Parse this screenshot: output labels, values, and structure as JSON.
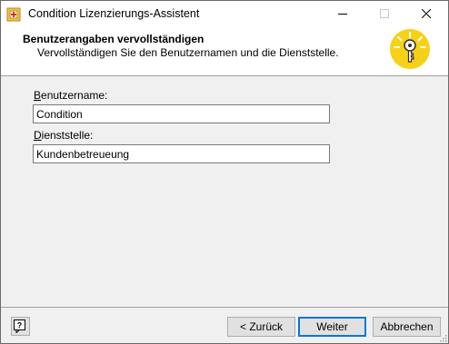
{
  "window": {
    "title": "Condition Lizenzierungs-Assistent"
  },
  "header": {
    "title": "Benutzerangaben vervollständigen",
    "subtitle": "Vervollständigen Sie den Benutzernamen und die Dienststelle."
  },
  "form": {
    "username": {
      "label_mnemonic": "B",
      "label_rest": "enutzername:",
      "value": "Condition"
    },
    "department": {
      "label_mnemonic": "D",
      "label_rest": "ienststelle:",
      "value": "Kundenbetreueung"
    }
  },
  "buttons": {
    "help_icon": "help-icon",
    "back_label": "< Zurück",
    "next_label": "Weiter",
    "cancel_label": "Abbrechen"
  },
  "icons": {
    "app": "app-icon",
    "key": "key-icon",
    "minimize": "minimize-icon",
    "maximize": "maximize-icon",
    "close": "close-icon"
  },
  "colors": {
    "key_badge": "#f7d117",
    "focus_border": "#0078d7"
  }
}
